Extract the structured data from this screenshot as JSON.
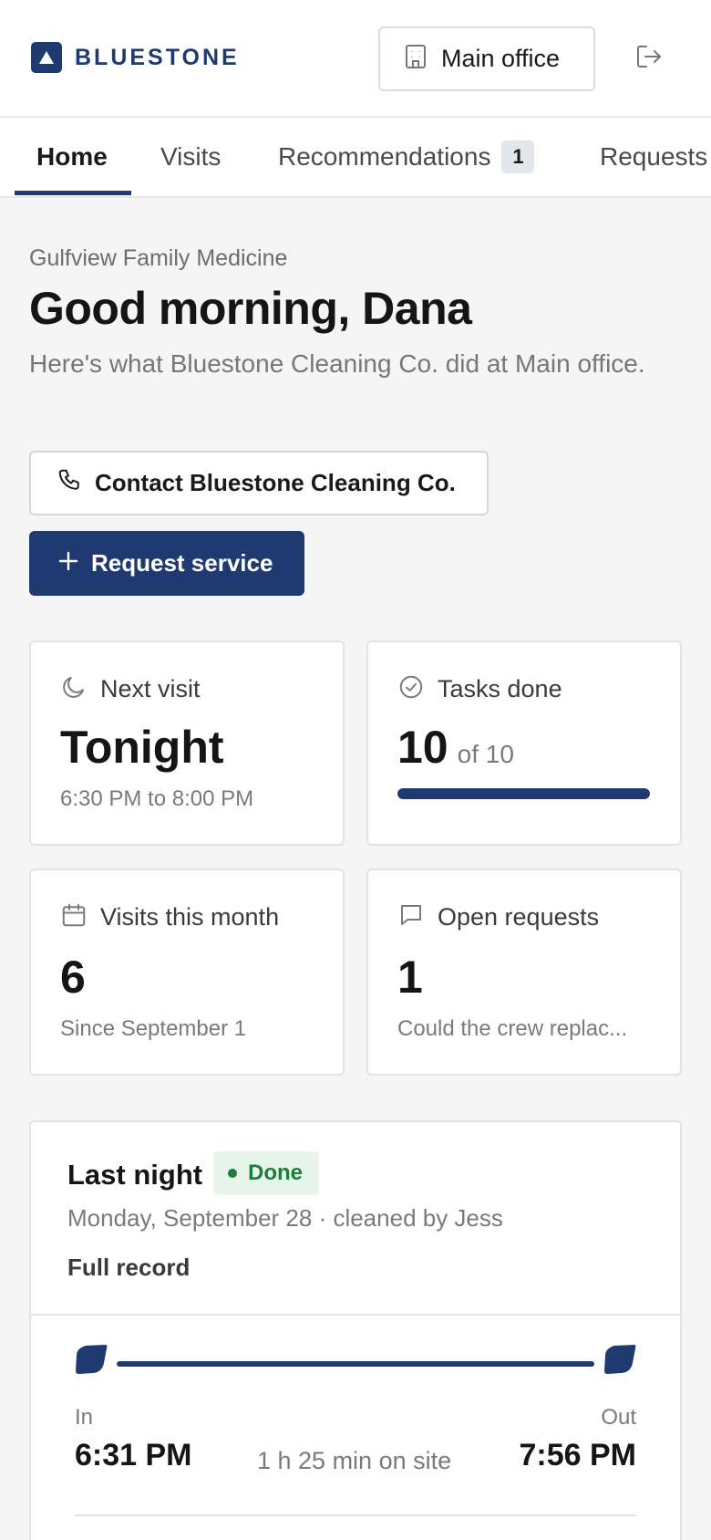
{
  "brand": {
    "name": "BLUESTONE",
    "color": "#1f3a70"
  },
  "header": {
    "site_label": "Main office",
    "site_icon": "building-icon",
    "signout_icon": "sign-out-icon"
  },
  "tabs": [
    {
      "label": "Home",
      "active": true
    },
    {
      "label": "Visits"
    },
    {
      "label": "Recommendations",
      "badge": "1"
    },
    {
      "label": "Requests"
    }
  ],
  "greeting": {
    "org": "Gulfview Family Medicine",
    "title": "Good morning, Dana",
    "subtitle": "Here's what Bluestone Cleaning Co. did at Main office."
  },
  "actions": {
    "contact_label": "Contact Bluestone Cleaning Co.",
    "contact_icon": "phone-icon",
    "request_label": "Request service",
    "request_icon": "plus-icon"
  },
  "stats": {
    "next_visit": {
      "label": "Next visit",
      "value": "Tonight",
      "sub": "6:30 PM to 8:00 PM",
      "icon": "moon-icon"
    },
    "tasks_done": {
      "label": "Tasks done",
      "value": "10",
      "of": "of 10",
      "progress": 1.0,
      "icon": "check-circle-icon"
    },
    "visits_month": {
      "label": "Visits this month",
      "value": "6",
      "sub": "Since September 1",
      "icon": "calendar-icon"
    },
    "open_requests": {
      "label": "Open requests",
      "value": "1",
      "sub": "Could the crew replac...",
      "icon": "message-icon"
    }
  },
  "last_visit": {
    "title": "Last night",
    "status": "Done",
    "meta": "Monday, September 28 · cleaned by Jess",
    "record_link": "Full record",
    "in_label": "In",
    "in_time": "6:31 PM",
    "out_label": "Out",
    "out_time": "7:56 PM",
    "duration": "1 h 25 min on site"
  }
}
